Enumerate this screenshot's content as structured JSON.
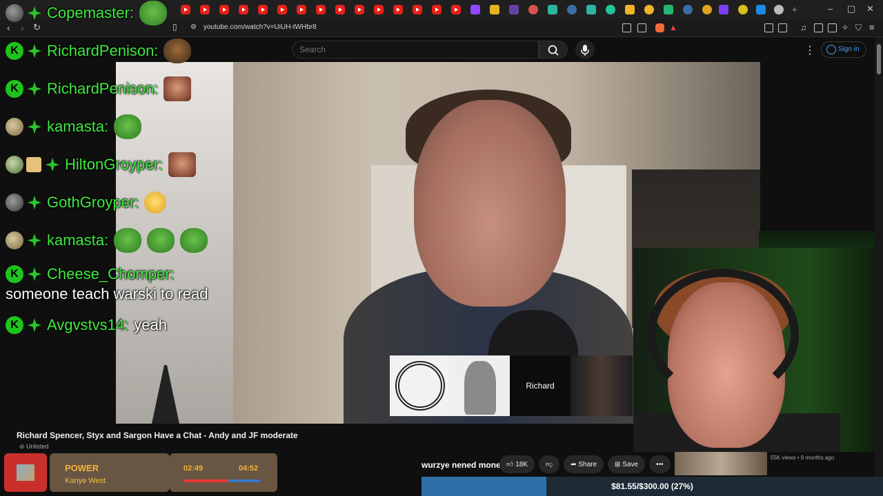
{
  "browser": {
    "url": "youtube.com/watch?v=UiUH-tWHbr8"
  },
  "youtube": {
    "search_placeholder": "Search",
    "signin_label": "Sign in",
    "video_title": "Richard Spencer, Styx and Sargon Have a Chat - Andy and JF moderate",
    "visibility": "Unlisted",
    "likes": "18K",
    "share_label": "Share",
    "save_label": "Save",
    "more_label": "•••",
    "side_video_meta": "55K views • 9 months ago"
  },
  "participants": {
    "name_tile": "Richard"
  },
  "chat": {
    "messages": [
      {
        "user": "Copemaster:",
        "text": ""
      },
      {
        "user": "RichardPenison:",
        "text": ""
      },
      {
        "user": "RichardPenison:",
        "text": ""
      },
      {
        "user": "kamasta:",
        "text": ""
      },
      {
        "user": "HiltonGroyper:",
        "text": ""
      },
      {
        "user": "GothGroyper:",
        "text": ""
      },
      {
        "user": "kamasta:",
        "text": ""
      },
      {
        "user": "Cheese_Chomper:",
        "text": "someone teach warski to read"
      },
      {
        "user": "Avgvstvs14:",
        "text": "yeah"
      }
    ]
  },
  "music": {
    "title": "POWER",
    "artist": "Kanye West",
    "time_current": "02:49",
    "time_total": "04:52",
    "progress": 0.58
  },
  "tts": {
    "text": "wurzye nened money"
  },
  "goal": {
    "text": "$81.55/$300.00 (27%)",
    "progress": 0.27
  },
  "colors": {
    "chat_name": "#3eea3e",
    "music_text": "#f5b33a",
    "goal_fill": "#2f6fa8",
    "youtube_red": "#e62117"
  }
}
